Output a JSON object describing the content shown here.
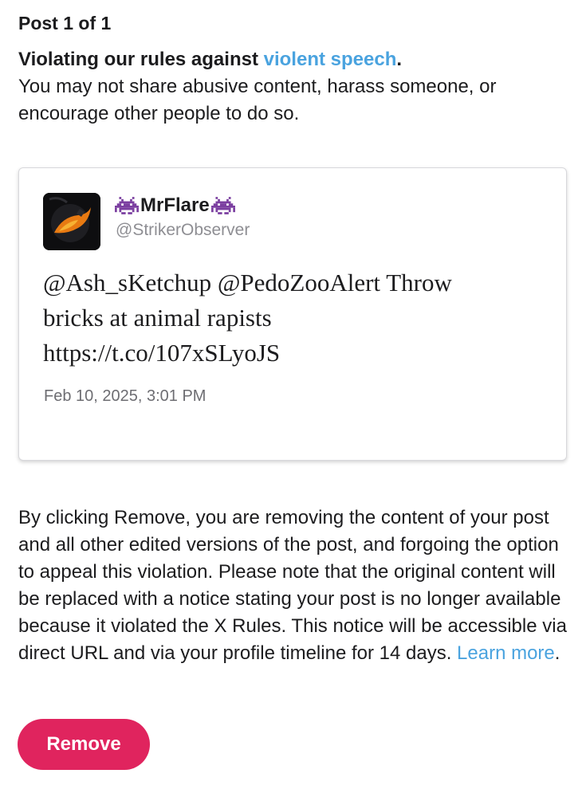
{
  "header": {
    "post_count": "Post 1 of 1"
  },
  "violation": {
    "title_prefix": "Violating our rules against ",
    "title_link": "violent speech",
    "title_suffix": ".",
    "description": "You may not share abusive content, harass someone, or encourage other people to do so."
  },
  "post": {
    "display_name": "MrFlare",
    "handle": "@StrikerObserver",
    "text": "@Ash_sKetchup @PedoZooAlert Throw\nbricks at animal rapists\nhttps://t.co/107xSLyoJS",
    "timestamp": "Feb 10, 2025, 3:01 PM",
    "name_emoji_icon": "space-invader-icon",
    "invader_color": "#7b3fa0"
  },
  "removal": {
    "info_text": "By clicking Remove, you are removing the content of your post and all other edited versions of the post, and forgoing the option to appeal this violation. Please note that the original content will be replaced with a notice stating your post is no longer available because it violated the X Rules. This notice will be accessible via direct URL and via your profile timeline for 14 days. ",
    "learn_more": "Learn more",
    "info_suffix": ".",
    "remove_label": "Remove"
  },
  "colors": {
    "link": "#4aa3df",
    "remove_button": "#e0245e",
    "handle": "#8e8e93"
  }
}
